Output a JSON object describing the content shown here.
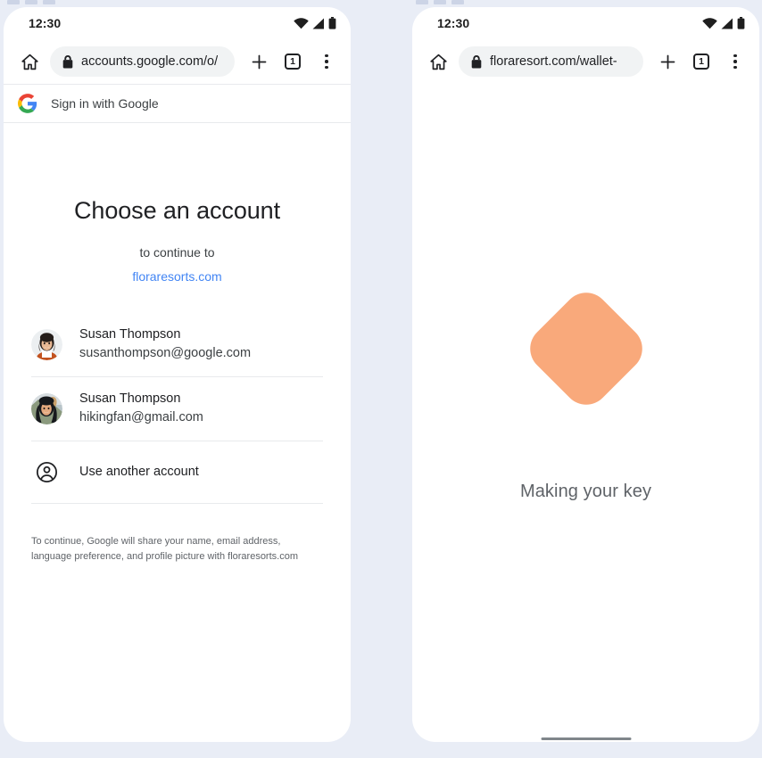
{
  "background_color": "#e9edf6",
  "panels": {
    "left": {
      "status_bar": {
        "time": "12:30",
        "icons": [
          "wifi-icon",
          "signal-icon",
          "battery-icon"
        ]
      },
      "browser": {
        "home_icon": "home-icon",
        "lock_icon": "lock-icon",
        "url": "accounts.google.com/o/",
        "new_tab_icon": "plus-icon",
        "tab_count": "1",
        "menu_icon": "kebab-menu-icon"
      },
      "google_header": {
        "logo": "google-g-icon",
        "title": "Sign in with Google"
      },
      "chooser": {
        "title": "Choose an account",
        "subtitle": "to continue to",
        "domain": "floraresorts.com",
        "domain_color": "#4285f4",
        "accounts": [
          {
            "name": "Susan Thompson",
            "email": "susanthompson@google.com",
            "avatar": "avatar-portrait-studio"
          },
          {
            "name": "Susan Thompson",
            "email": "hikingfan@gmail.com",
            "avatar": "avatar-portrait-outdoor"
          }
        ],
        "use_another_account": {
          "label": "Use another account",
          "icon": "account-circle-icon"
        },
        "legal_text": "To continue, Google will share your name, email address, language preference, and profile picture with floraresorts.com"
      }
    },
    "right": {
      "status_bar": {
        "time": "12:30",
        "icons": [
          "wifi-icon",
          "signal-icon",
          "battery-icon"
        ]
      },
      "browser": {
        "home_icon": "home-icon",
        "lock_icon": "lock-icon",
        "url": "floraresort.com/wallet-",
        "new_tab_icon": "plus-icon",
        "tab_count": "1",
        "menu_icon": "kebab-menu-icon"
      },
      "content": {
        "shape_color": "#f9a97b",
        "shape_name": "rotated-rounded-square",
        "status_label": "Making your key"
      }
    }
  }
}
